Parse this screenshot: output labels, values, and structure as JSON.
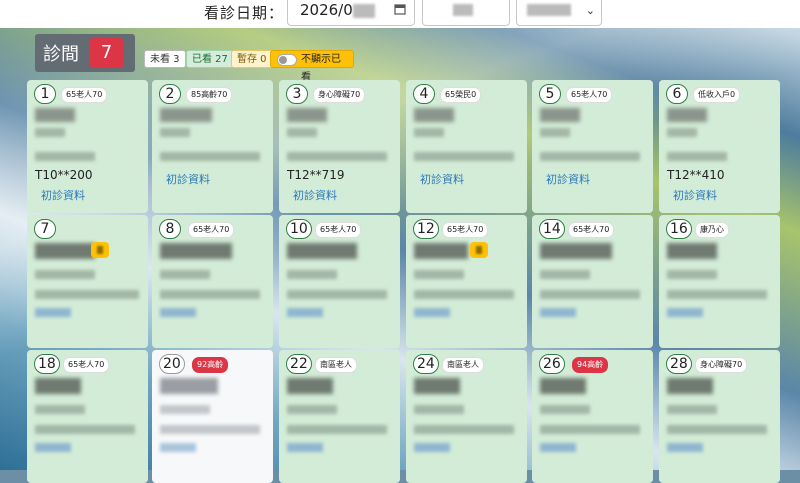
{
  "header": {
    "date_label": "看診日期：",
    "date_value": "2026/0"
  },
  "room": {
    "label": "診間",
    "number": "7"
  },
  "filters": {
    "unseen": "未看 3",
    "seen": "已看 27",
    "draft": "暫存 0",
    "hide_seen": "不顯示已看"
  },
  "cards": [
    {
      "num": "1",
      "tag": "65老人70",
      "id": "",
      "link": "初診資料"
    },
    {
      "num": "2",
      "tag": "85高齡70",
      "id": "",
      "link": "初診資料"
    },
    {
      "num": "3",
      "tag": "身心障礙70",
      "id": "T12**719",
      "link": "初診資料"
    },
    {
      "num": "4",
      "tag": "65榮民0",
      "id": "",
      "link": "初診資料"
    },
    {
      "num": "5",
      "tag": "65老人70",
      "id": "",
      "link": "初診資料"
    },
    {
      "num": "6",
      "tag": "低收入戶0",
      "id": "T12**410",
      "link": "初診資料"
    },
    {
      "num": "7",
      "tag": ""
    },
    {
      "num": "8",
      "tag": "65老人70"
    },
    {
      "num": "10",
      "tag": "65老人70"
    },
    {
      "num": "12",
      "tag": "65老人70"
    },
    {
      "num": "14",
      "tag": "65老人70"
    },
    {
      "num": "16",
      "tag": "康乃心"
    },
    {
      "num": "18",
      "tag": "65老人70"
    },
    {
      "num": "20",
      "tag": "92高齡"
    },
    {
      "num": "22",
      "tag": "南區老人"
    },
    {
      "num": "24",
      "tag": "南區老人"
    },
    {
      "num": "26",
      "tag": "94高齡"
    },
    {
      "num": "28",
      "tag": "身心障礙70"
    }
  ],
  "card1_id": "T10**200"
}
